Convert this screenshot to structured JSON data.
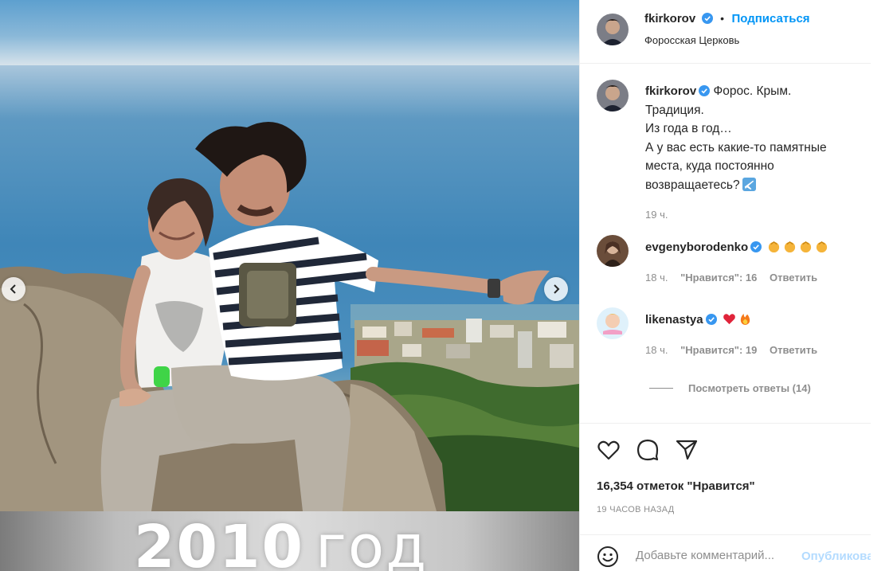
{
  "post": {
    "author": "fkirkorov",
    "follow_label": "Подписаться",
    "dot": "•",
    "location": "Форосская Церковь",
    "photo_caption_year": "2010",
    "photo_caption_word": "год"
  },
  "caption": {
    "username": "fkirkorov",
    "lines": [
      "Форос. Крым.",
      "Традиция.",
      "Из года в год…",
      "А у вас есть какие-то памятные",
      "места, куда постоянно",
      "возвращаетесь?"
    ],
    "time": "19 ч."
  },
  "comments": [
    {
      "username": "evgenyborodenko",
      "emojis": [
        "clapping-hands",
        "clapping-hands",
        "clapping-hands",
        "clapping-hands"
      ],
      "time": "18 ч.",
      "likes": "\"Нравится\": 16",
      "reply": "Ответить"
    },
    {
      "username": "likenastya",
      "emojis": [
        "red-heart",
        "fire"
      ],
      "time": "18 ч.",
      "likes": "\"Нравится\": 19",
      "reply": "Ответить"
    }
  ],
  "view_replies": "Посмотреть ответы (14)",
  "stats": {
    "likes": "16,354 отметок \"Нравится\"",
    "posted": "19 ЧАСОВ НАЗАД"
  },
  "add_comment": {
    "placeholder": "Добавьте комментарий...",
    "publish": "Опубликовать"
  },
  "colors": {
    "accent": "#0095f6",
    "verified": "#3897f0",
    "muted": "#8e8e8e",
    "text": "#262626",
    "border": "#efefef"
  },
  "icons": [
    "verified-badge-icon",
    "heart-icon",
    "comment-icon",
    "share-icon",
    "smile-icon",
    "chevron-left-icon",
    "chevron-right-icon",
    "airplane-emoji"
  ]
}
